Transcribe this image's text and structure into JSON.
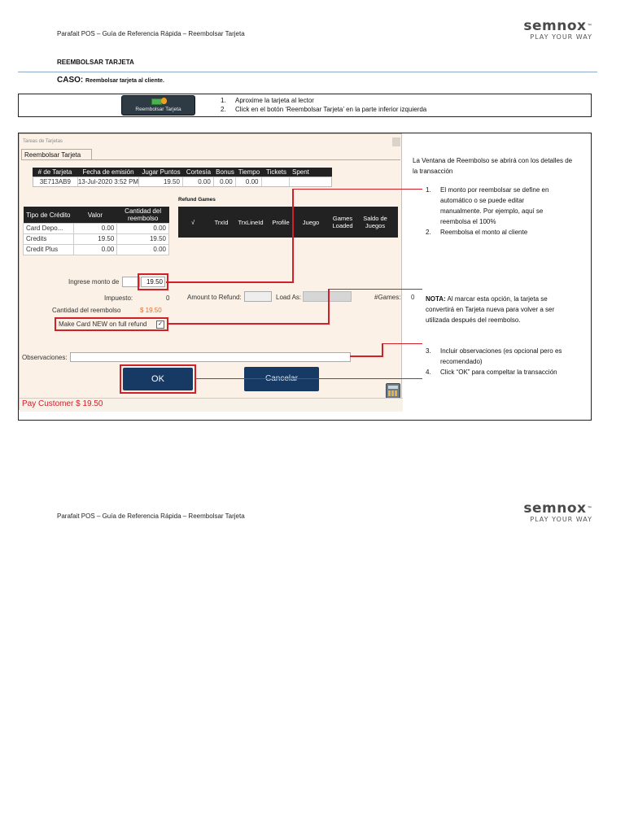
{
  "doc": {
    "header_title": "Parafait POS – Guía de Referencia Rápida – Reembolsar Tarjeta",
    "logo_text": "semnox",
    "logo_tm": "™",
    "logo_tagline": "PLAY YOUR WAY",
    "section_title": "REEMBOLSAR TARJETA",
    "caso_label": "CASO:",
    "caso_text": "Reembolsar tarjeta al cliente."
  },
  "steps_box": {
    "button_label": "Reembolsar Tarjeta",
    "steps": [
      {
        "num": "1.",
        "text": "Aproxime la tarjeta al lector"
      },
      {
        "num": "2.",
        "text": "Click en el botón ‘Reembolsar Tarjeta’ en la parte inferior izquierda"
      }
    ]
  },
  "window": {
    "title": "Tareas de Tarjetas",
    "tab": "Reembolsar Tarjeta",
    "card_columns": [
      "# de Tarjeta",
      "Fecha de emisión",
      "Jugar Puntos",
      "Cortesía",
      "Bonus",
      "Tiempo",
      "Tickets",
      "Spent"
    ],
    "card_values": [
      "3E713AB9",
      "13-Jul-2020 3:52 PM",
      "19.50",
      "0.00",
      "0.00",
      "0.00",
      "",
      ""
    ],
    "credit_columns": [
      "Tipo de Crédito",
      "Valor",
      "Cantidad del reembolso"
    ],
    "credit_rows": [
      [
        "Card Depo...",
        "0.00",
        "0.00"
      ],
      [
        "Credits",
        "19.50",
        "19.50"
      ],
      [
        "Credit Plus",
        "0.00",
        "0.00"
      ]
    ],
    "refund_games_title": "Refund Games",
    "games_columns": [
      "√",
      "TrxId",
      "TrxLineId",
      "Profile",
      "Juego",
      "Games Loaded",
      "Saldo de Juegos"
    ],
    "amount_label": "Ingrese monto de",
    "amount_value": "19.50",
    "tax_label": "Impuesto:",
    "tax_value": "0",
    "refund_qty_label": "Cantidad del reembolso",
    "refund_qty_value": "$ 19.50",
    "make_new_label": "Make Card NEW on full refund",
    "amount_to_refund_label": "Amount to Refund:",
    "load_as_label": "Load As:",
    "games_count_label": "#Games:",
    "games_count_value": "0",
    "obs_label": "Observaciones:",
    "ok_label": "OK",
    "cancel_label": "Cancelar",
    "status_text": "Pay Customer $ 19.50"
  },
  "annotations": {
    "intro": "La Ventana de Reembolso se abrirá con los detalles de la transacción",
    "list1": [
      {
        "num": "1.",
        "text": "El monto por reembolsar se define en automático o se puede editar manualmente. Por ejemplo, aquí se reembolsa el 100%"
      },
      {
        "num": "2.",
        "text": "Reembolsa el monto al cliente"
      }
    ],
    "note_label": "NOTA:",
    "note_text": " Al marcar esta opción, la tarjeta se convertirá en Tarjeta nueva para volver a ser utilizada después del reembolso.",
    "list2": [
      {
        "num": "3.",
        "text": "Incluir observaciones (es opcional pero es recomendado)"
      },
      {
        "num": "4.",
        "text": "Click “OK” para compeltar la transacción"
      }
    ]
  },
  "colors": {
    "accent_red": "#d0202a",
    "button_navy": "#163a64",
    "window_bg": "#fbf1e6"
  }
}
